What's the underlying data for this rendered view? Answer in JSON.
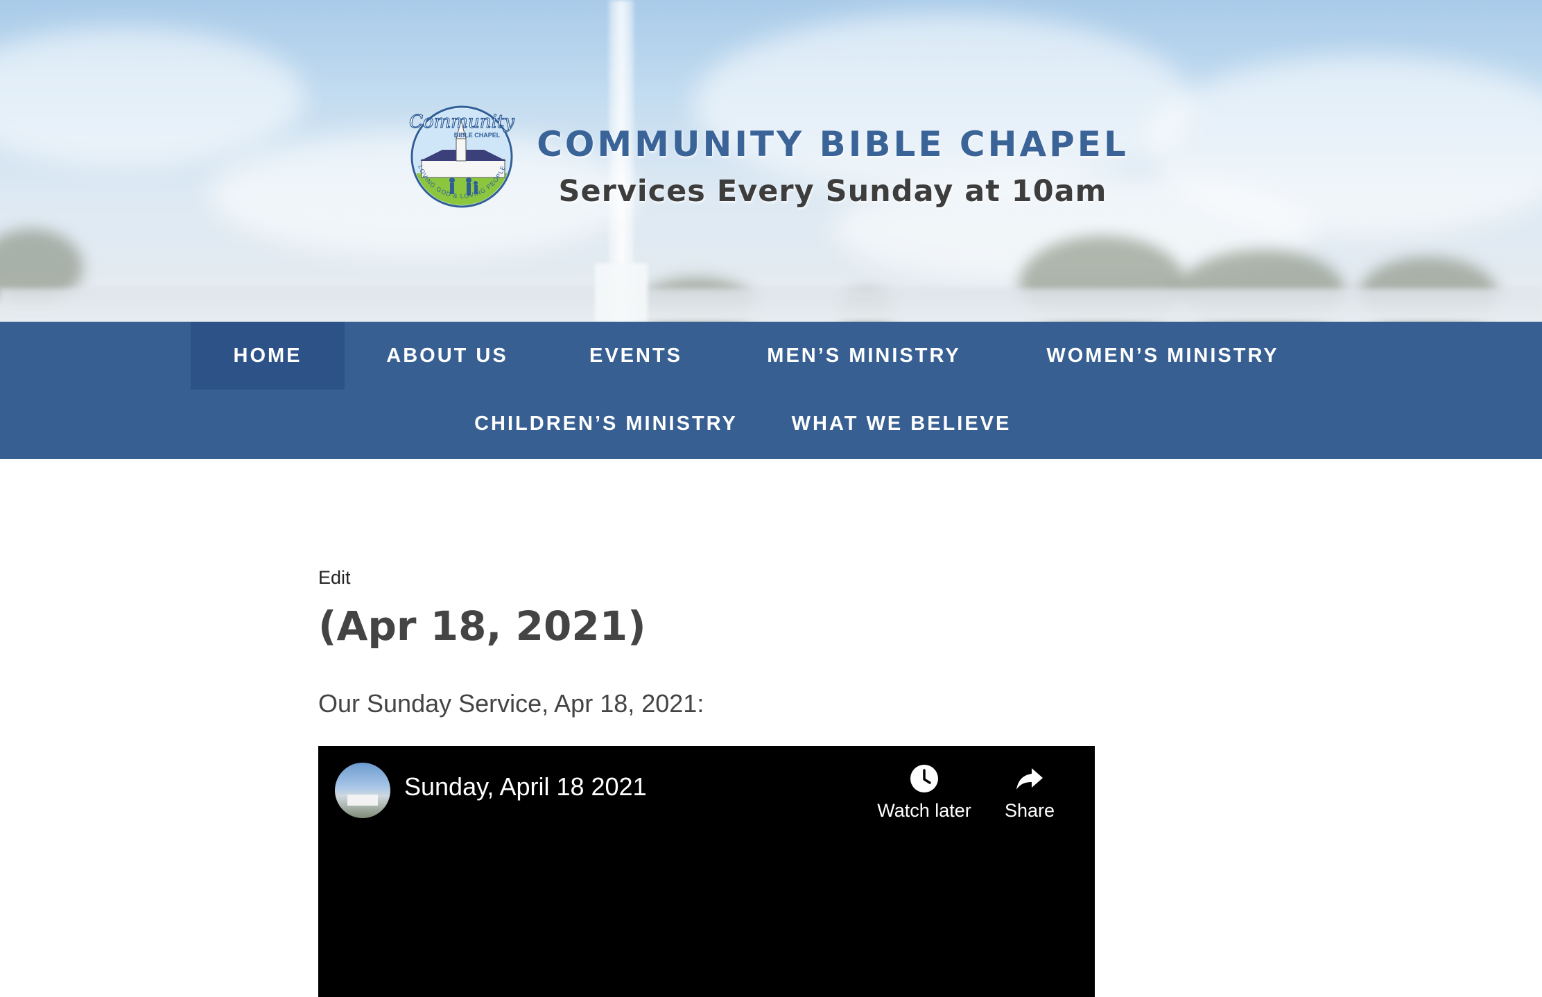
{
  "header": {
    "site_title": "COMMUNITY BIBLE CHAPEL",
    "tagline": "Services Every Sunday at 10am",
    "logo": {
      "word": "Community",
      "sub": "BIBLE CHAPEL",
      "ring_text": "LOVING GOD & LOVING PEOPLE"
    }
  },
  "nav": {
    "items": [
      {
        "label": "HOME",
        "active": true
      },
      {
        "label": "ABOUT US"
      },
      {
        "label": "EVENTS"
      },
      {
        "label": "MEN’S MINISTRY"
      },
      {
        "label": "WOMEN’S MINISTRY"
      },
      {
        "label": "CHILDREN’S MINISTRY"
      },
      {
        "label": "WHAT WE BELIEVE"
      }
    ]
  },
  "post": {
    "edit_label": "Edit",
    "title": "(Apr 18, 2021)",
    "intro": "Our Sunday Service, Apr 18, 2021:"
  },
  "video": {
    "title": "Sunday, April 18 2021",
    "watch_later_label": "Watch later",
    "share_label": "Share",
    "icons": [
      "clock-icon",
      "share-arrow-icon"
    ]
  },
  "colors": {
    "nav_bg": "#375f92",
    "nav_active_bg": "#2d5287",
    "title_blue": "#3a6398",
    "text_dark": "#444444"
  }
}
